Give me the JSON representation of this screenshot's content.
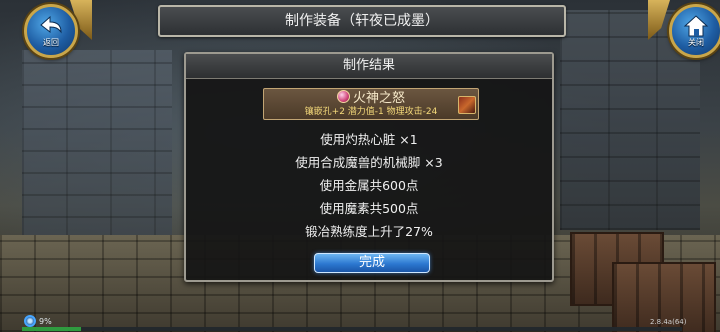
{
  "window": {
    "title": "制作装备（轩夜已成墨）"
  },
  "nav": {
    "back_label": "返回",
    "close_label": "关闭"
  },
  "dialog": {
    "header": "制作结果",
    "item": {
      "name": "火神之怒",
      "stats": "镶嵌孔+2 潜力值-1 物理攻击-24"
    },
    "lines": [
      "使用灼热心脏 ×1",
      "使用合成魔兽的机械脚 ×3",
      "使用金属共600点",
      "使用魔素共500点",
      "锻冶熟练度上升了27%"
    ],
    "confirm_label": "完成"
  },
  "status": {
    "progress_text": "9%",
    "progress": 0.09,
    "version": "2.8.4a(64)"
  },
  "colors": {
    "accent_blue": "#2c78d0",
    "stat_gold": "#f4d97a",
    "item_bg": "#5b4733"
  }
}
